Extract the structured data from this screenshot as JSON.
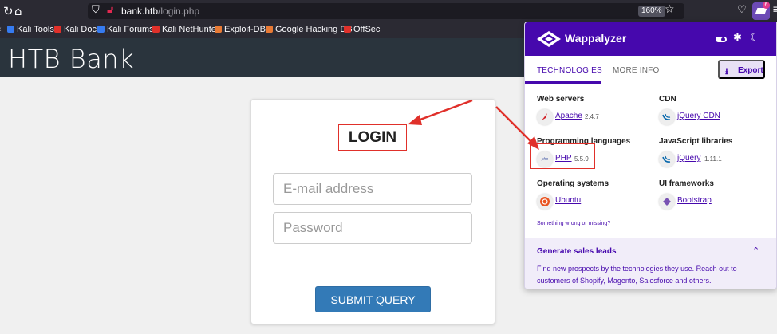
{
  "browser": {
    "url_host": "bank.htb",
    "url_path": "/login.php",
    "zoom": "160%",
    "ext_badge": "6",
    "icons": {
      "reload": "reload-icon",
      "home": "home-icon",
      "shield": "shield-icon",
      "lock": "lock-icon",
      "star": "star-icon",
      "pocket": "pocket-icon",
      "menu": "menu-icon"
    },
    "bookmarks": [
      {
        "label": "Kali Tools",
        "color": "#367bf0"
      },
      {
        "label": "Kali Docs",
        "color": "#e0302a"
      },
      {
        "label": "Kali Forums",
        "color": "#367bf0"
      },
      {
        "label": "Kali NetHunter",
        "color": "#e0302a"
      },
      {
        "label": "Exploit-DB",
        "color": "#e87a35"
      },
      {
        "label": "Google Hacking DB",
        "color": "#e87a35"
      },
      {
        "label": "OffSec",
        "color": "#e0302a"
      }
    ]
  },
  "page": {
    "site_title": "HTB Bank",
    "login_title": "LOGIN",
    "email_placeholder": "E-mail address",
    "password_placeholder": "Password",
    "submit_label": "SUBMIT QUERY"
  },
  "wappalyzer": {
    "name": "Wappalyzer",
    "tabs": {
      "technologies": "TECHNOLOGIES",
      "more_info": "MORE INFO"
    },
    "export_label": "Export",
    "categories": [
      {
        "title": "Web servers",
        "tech": "Apache",
        "version": "2.4.7",
        "icon": "apache-feather-icon"
      },
      {
        "title": "CDN",
        "tech": "jQuery CDN",
        "version": "",
        "icon": "jquery-icon"
      },
      {
        "title": "Programming languages",
        "tech": "PHP",
        "version": "5.5.9",
        "icon": "php-icon"
      },
      {
        "title": "JavaScript libraries",
        "tech": "jQuery",
        "version": "1.11.1",
        "icon": "jquery-icon"
      },
      {
        "title": "Operating systems",
        "tech": "Ubuntu",
        "version": "",
        "icon": "ubuntu-icon"
      },
      {
        "title": "UI frameworks",
        "tech": "Bootstrap",
        "version": "",
        "icon": "bootstrap-icon"
      }
    ],
    "php_icon_text": "php",
    "wrong_link": "Something wrong or missing?",
    "leads_title": "Generate sales leads",
    "leads_text": "Find new prospects by the technologies they use. Reach out to customers of Shopify, Magento, Salesforce and others.",
    "accent": "#4608ad"
  },
  "annotation_color": "#e0302a"
}
